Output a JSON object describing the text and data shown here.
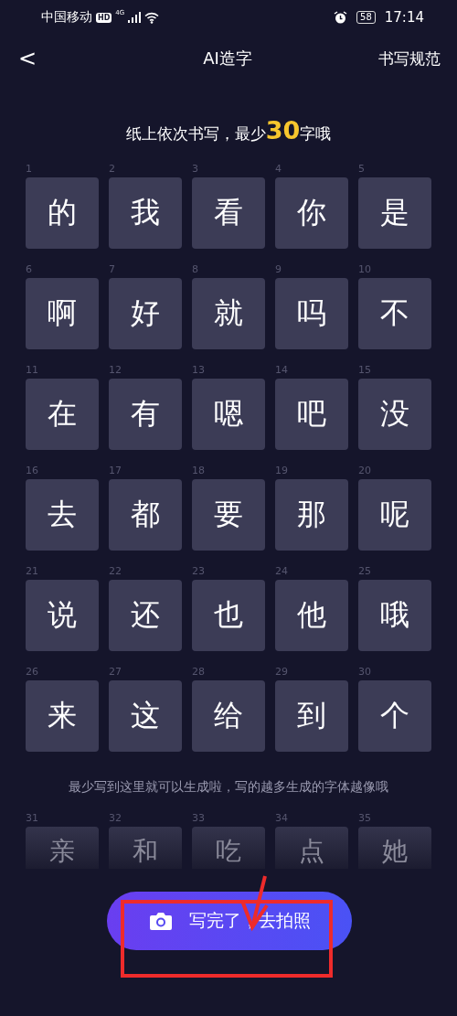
{
  "status_bar": {
    "carrier": "中国移动",
    "hd_badge": "HD",
    "network": "4G",
    "battery": "58",
    "time": "17:14"
  },
  "header": {
    "back": "<",
    "title": "AI造字",
    "action": "书写规范"
  },
  "instruction": {
    "before": "纸上依次书写，最少",
    "count": "30",
    "after": "字哦"
  },
  "characters": [
    {
      "number": "1",
      "char": "的"
    },
    {
      "number": "2",
      "char": "我"
    },
    {
      "number": "3",
      "char": "看"
    },
    {
      "number": "4",
      "char": "你"
    },
    {
      "number": "5",
      "char": "是"
    },
    {
      "number": "6",
      "char": "啊"
    },
    {
      "number": "7",
      "char": "好"
    },
    {
      "number": "8",
      "char": "就"
    },
    {
      "number": "9",
      "char": "吗"
    },
    {
      "number": "10",
      "char": "不"
    },
    {
      "number": "11",
      "char": "在"
    },
    {
      "number": "12",
      "char": "有"
    },
    {
      "number": "13",
      "char": "嗯"
    },
    {
      "number": "14",
      "char": "吧"
    },
    {
      "number": "15",
      "char": "没"
    },
    {
      "number": "16",
      "char": "去"
    },
    {
      "number": "17",
      "char": "都"
    },
    {
      "number": "18",
      "char": "要"
    },
    {
      "number": "19",
      "char": "那"
    },
    {
      "number": "20",
      "char": "呢"
    },
    {
      "number": "21",
      "char": "说"
    },
    {
      "number": "22",
      "char": "还"
    },
    {
      "number": "23",
      "char": "也"
    },
    {
      "number": "24",
      "char": "他"
    },
    {
      "number": "25",
      "char": "哦"
    },
    {
      "number": "26",
      "char": "来"
    },
    {
      "number": "27",
      "char": "这"
    },
    {
      "number": "28",
      "char": "给"
    },
    {
      "number": "29",
      "char": "到"
    },
    {
      "number": "30",
      "char": "个"
    }
  ],
  "note": "最少写到这里就可以生成啦，写的越多生成的字体越像哦",
  "extra_characters": [
    {
      "number": "31",
      "char": "亲"
    },
    {
      "number": "32",
      "char": "和"
    },
    {
      "number": "33",
      "char": "吃"
    },
    {
      "number": "34",
      "char": "点"
    },
    {
      "number": "35",
      "char": "她"
    }
  ],
  "photo_button": {
    "label": "写完了，去拍照"
  }
}
